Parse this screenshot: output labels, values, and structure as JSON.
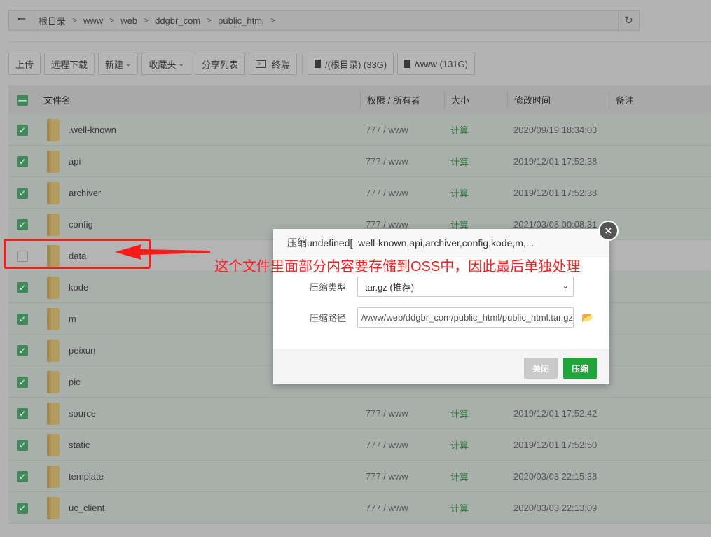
{
  "breadcrumb": [
    "根目录",
    "www",
    "web",
    "ddgbr_com",
    "public_html"
  ],
  "toolbar": {
    "upload": "上传",
    "remote_download": "远程下载",
    "new": "新建",
    "favorites": "收藏夹",
    "share_list": "分享列表",
    "terminal": "终端",
    "disk_root": "/(根目录) (33G)",
    "disk_www": "/www (131G)"
  },
  "table": {
    "headers": {
      "name": "文件名",
      "perm": "权限 / 所有者",
      "size": "大小",
      "mtime": "修改时间",
      "note": "备注"
    },
    "rows": [
      {
        "name": ".well-known",
        "perm": "777 / www",
        "size": "计算",
        "mtime": "2020/09/19 18:34:03",
        "checked": true
      },
      {
        "name": "api",
        "perm": "777 / www",
        "size": "计算",
        "mtime": "2019/12/01 17:52:38",
        "checked": true
      },
      {
        "name": "archiver",
        "perm": "777 / www",
        "size": "计算",
        "mtime": "2019/12/01 17:52:38",
        "checked": true
      },
      {
        "name": "config",
        "perm": "777 / www",
        "size": "计算",
        "mtime": "2021/03/08 00:08:31",
        "checked": true
      },
      {
        "name": "data",
        "perm": "",
        "size": "",
        "mtime": "",
        "checked": false
      },
      {
        "name": "kode",
        "perm": "",
        "size": "",
        "mtime": "",
        "checked": true
      },
      {
        "name": "m",
        "perm": "",
        "size": "",
        "mtime": "",
        "checked": true
      },
      {
        "name": "peixun",
        "perm": "",
        "size": "",
        "mtime": "",
        "checked": true
      },
      {
        "name": "pic",
        "perm": "",
        "size": "",
        "mtime": "",
        "checked": true
      },
      {
        "name": "source",
        "perm": "777 / www",
        "size": "计算",
        "mtime": "2019/12/01 17:52:42",
        "checked": true
      },
      {
        "name": "static",
        "perm": "777 / www",
        "size": "计算",
        "mtime": "2019/12/01 17:52:50",
        "checked": true
      },
      {
        "name": "template",
        "perm": "777 / www",
        "size": "计算",
        "mtime": "2020/03/03 22:15:38",
        "checked": true
      },
      {
        "name": "uc_client",
        "perm": "777 / www",
        "size": "计算",
        "mtime": "2020/03/03 22:13:09",
        "checked": true
      }
    ]
  },
  "modal": {
    "title": "压缩undefined[ .well-known,api,archiver,config,kode,m,...",
    "type_label": "压缩类型",
    "type_value": "tar.gz (推荐)",
    "path_label": "压缩路径",
    "path_value": "/www/web/ddgbr_com/public_html/public_html.tar.gz",
    "close_btn": "关闭",
    "compress_btn": "压缩",
    "colors": {
      "primary": "#20a53a",
      "disabled": "#c9c9c9"
    }
  },
  "annotation": {
    "text": "这个文件里面部分内容要存储到OSS中，因此最后单独处理",
    "color": "#ff1a1a"
  }
}
